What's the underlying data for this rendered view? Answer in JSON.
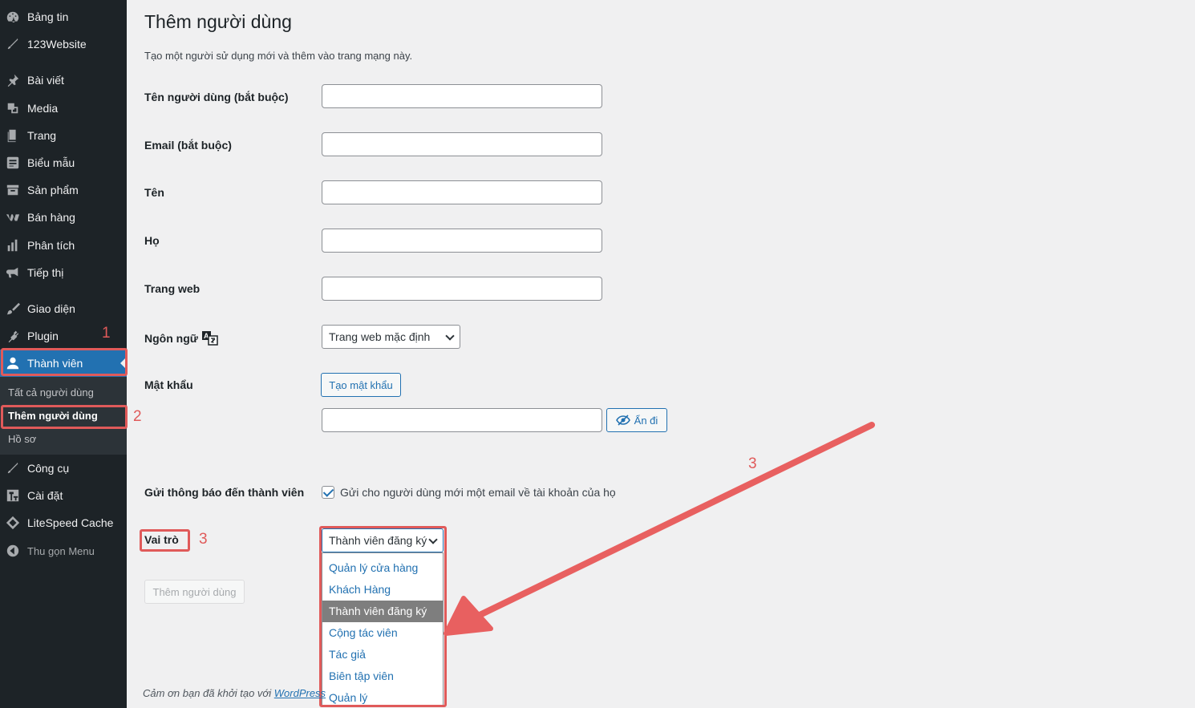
{
  "sidebar": {
    "items": [
      {
        "label": "Bảng tin",
        "icon": "dashboard-icon"
      },
      {
        "label": "123Website",
        "icon": "wrench-icon"
      },
      {
        "label": "Bài viết",
        "icon": "pin-icon"
      },
      {
        "label": "Media",
        "icon": "media-icon"
      },
      {
        "label": "Trang",
        "icon": "page-icon"
      },
      {
        "label": "Biểu mẫu",
        "icon": "form-icon"
      },
      {
        "label": "Sản phẩm",
        "icon": "archive-icon"
      },
      {
        "label": "Bán hàng",
        "icon": "woo-icon"
      },
      {
        "label": "Phân tích",
        "icon": "chart-icon"
      },
      {
        "label": "Tiếp thị",
        "icon": "megaphone-icon"
      },
      {
        "label": "Giao diện",
        "icon": "brush-icon"
      },
      {
        "label": "Plugin",
        "icon": "plugin-icon"
      },
      {
        "label": "Thành viên",
        "icon": "user-icon"
      },
      {
        "label": "Công cụ",
        "icon": "wrench-icon"
      },
      {
        "label": "Cài đặt",
        "icon": "settings-icon"
      },
      {
        "label": "LiteSpeed Cache",
        "icon": "diamond-icon"
      }
    ],
    "submenu": [
      "Tất cả người dùng",
      "Thêm người dùng",
      "Hồ sơ"
    ],
    "collapse_label": "Thu gọn Menu"
  },
  "annotations": {
    "n1": "1",
    "n2": "2",
    "n3a": "3",
    "n3b": "3"
  },
  "page": {
    "title": "Thêm người dùng",
    "description": "Tạo một người sử dụng mới và thêm vào trang mạng này."
  },
  "form": {
    "username_label": "Tên người dùng (bắt buộc)",
    "email_label": "Email (bắt buộc)",
    "first_name_label": "Tên",
    "last_name_label": "Họ",
    "website_label": "Trang web",
    "language_label": "Ngôn ngữ",
    "language_value": "Trang web mặc định",
    "password_label": "Mật khẩu",
    "generate_password": "Tạo mật khẩu",
    "hide_label": "Ẩn đi",
    "notify_label": "Gửi thông báo đến thành viên",
    "notify_text": "Gửi cho người dùng mới một email về tài khoản của họ",
    "role_label": "Vai trò",
    "role_value": "Thành viên đăng ký",
    "role_options": [
      "Quản lý cửa hàng",
      "Khách Hàng",
      "Thành viên đăng ký",
      "Cộng tác viên",
      "Tác giả",
      "Biên tập viên",
      "Quản lý"
    ],
    "submit_label": "Thêm người dùng"
  },
  "footer": {
    "text": "Cảm ơn bạn đã khởi tạo với ",
    "link": "WordPress"
  },
  "colors": {
    "accent": "#2271b1",
    "annotation": "#e05a5a",
    "sidebar": "#1d2327"
  }
}
